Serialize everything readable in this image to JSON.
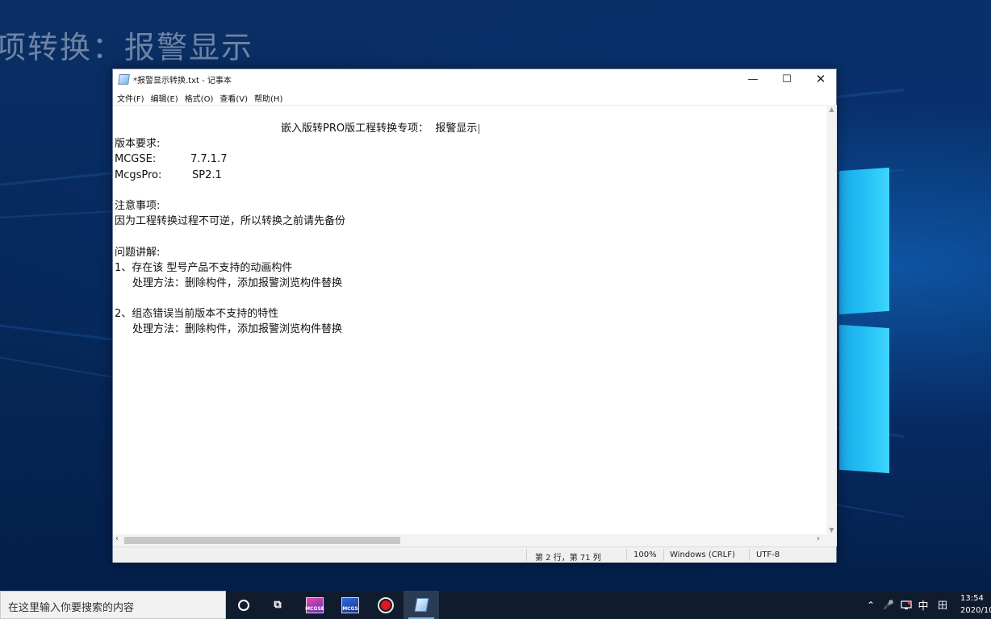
{
  "desktop": {
    "background_title": "项转换：报警显示",
    "accent_color": "#27c4f6"
  },
  "window": {
    "title": "*报警显示转换.txt - 记事本",
    "controls": {
      "minimize": "—",
      "maximize": "☐",
      "close": "✕"
    },
    "menu": [
      "文件(F)",
      "编辑(E)",
      "格式(O)",
      "查看(V)",
      "帮助(H)"
    ]
  },
  "document": {
    "heading": "嵌入版转PRO版工程转换专项：  报警显示",
    "version_label": "版本要求:",
    "versions": [
      {
        "name": "MCGSE:",
        "value": "7.7.1.7"
      },
      {
        "name": "McgsPro:",
        "value": "SP2.1"
      }
    ],
    "notice_label": "注意事项:",
    "notice_text": "因为工程转换过程不可逆，所以转换之前请先备份",
    "issues_label": "问题讲解:",
    "issues": [
      {
        "title": "1、存在该 型号产品不支持的动画构件",
        "solution": "处理方法：删除构件，添加报警浏览构件替换"
      },
      {
        "title": "2、组态错误当前版本不支持的特性",
        "solution": "处理方法：删除构件，添加报警浏览构件替换"
      }
    ]
  },
  "statusbar": {
    "position": "第 2 行，第 71 列",
    "zoom": "100%",
    "line_ending": "Windows (CRLF)",
    "encoding": "UTF-8"
  },
  "taskbar": {
    "search_placeholder": "在这里输入你要搜索的内容",
    "apps": [
      {
        "name": "cortana-icon"
      },
      {
        "name": "task-view-icon",
        "glyph": "⧉"
      },
      {
        "name": "mcgse-app-icon",
        "label": "MCGSE"
      },
      {
        "name": "mcgs-app-icon",
        "label": "MCGS"
      },
      {
        "name": "recorder-app-icon"
      },
      {
        "name": "notepad-app-icon"
      }
    ],
    "tray": {
      "chevron": "⌃",
      "mic": "🎤",
      "ime_mode": "中",
      "ime_layout": "田",
      "time": "13:54",
      "date": "2020/10"
    }
  }
}
